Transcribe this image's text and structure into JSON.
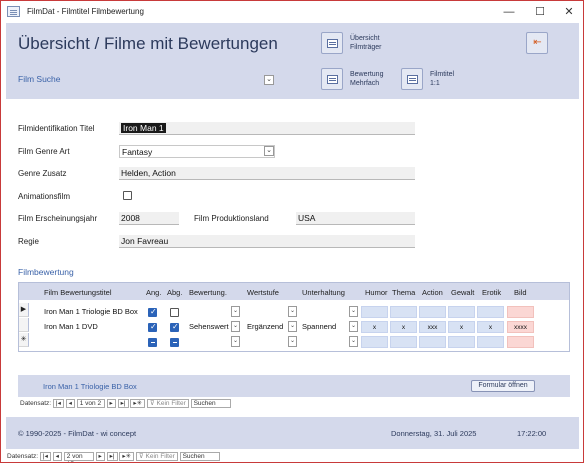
{
  "window": {
    "title": "FilmDat - Filmtitel Filmbewertung",
    "minimize": "—",
    "maximize": "☐",
    "close": "✕"
  },
  "header": {
    "title": "Übersicht / Filme mit Bewertungen",
    "search_label": "Film Suche",
    "btn_uebersicht_1": "Übersicht",
    "btn_uebersicht_2": "Filmträger",
    "btn_bewertung_1": "Bewertung",
    "btn_bewertung_2": "Mehrfach",
    "btn_filmtitel_1": "Filmtitel",
    "btn_filmtitel_2": "1:1"
  },
  "form": {
    "id_label": "Filmidentifikation Titel",
    "id_value": "Iron Man 1",
    "genre_label": "Film Genre Art",
    "genre_value": "Fantasy",
    "zusatz_label": "Genre Zusatz",
    "zusatz_value": "Helden, Action",
    "anim_label": "Animationsfilm",
    "jahr_label": "Film Erscheinungsjahr",
    "jahr_value": "2008",
    "land_label": "Film Produktionsland",
    "land_value": "USA",
    "regie_label": "Regie",
    "regie_value": "Jon Favreau"
  },
  "subform": {
    "title": "Filmbewertung",
    "columns": [
      "Film Bewertungstitel",
      "Ang.",
      "Abg.",
      "Bewertung.",
      "Wertstufe",
      "Unterhaltung",
      "Humor",
      "Thema",
      "Action",
      "Gewalt",
      "Erotik",
      "Bild"
    ],
    "rows": [
      {
        "titel": "Iron Man 1 Triologie BD Box",
        "bewertung": "",
        "wertstufe": "",
        "unterhaltung": "",
        "humor": "",
        "thema": "",
        "action": "",
        "gewalt": "",
        "erotik": "",
        "bild": ""
      },
      {
        "titel": "Iron Man 1 DVD",
        "bewertung": "Sehenswert",
        "wertstufe": "Ergänzend",
        "unterhaltung": "Spannend",
        "humor": "x",
        "thema": "x",
        "action": "xxx",
        "gewalt": "x",
        "erotik": "x",
        "bild": "xxxx"
      }
    ],
    "new_row_marker": "✳",
    "current_row_marker": "▶",
    "footer_title": "Iron Man 1 Triologie BD Box",
    "open_button": "Formular öffnen",
    "nav_label": "Datensatz:",
    "nav_pos": "1 von 2",
    "nav_filter": "Kein Filter",
    "nav_search": "Suchen"
  },
  "footer": {
    "copyright": "© 1990-2025 - FilmDat - wi concept",
    "date": "Donnerstag, 31. Juli 2025",
    "time": "17:22:00"
  },
  "statusnav": {
    "label": "Datensatz:",
    "pos": "2 von 15",
    "filter": "Kein Filter",
    "search": "Suchen"
  }
}
